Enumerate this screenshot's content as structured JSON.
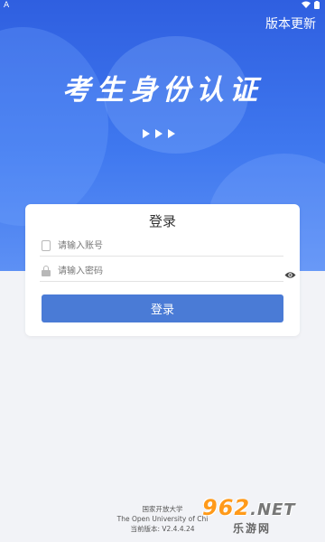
{
  "status_bar": {
    "left_icon": "A"
  },
  "header": {
    "update_label": "版本更新"
  },
  "hero": {
    "title": "考生身份认证"
  },
  "login_card": {
    "title": "登录",
    "account_placeholder": "请输入账号",
    "password_placeholder": "请输入密码",
    "login_button": "登录"
  },
  "footer": {
    "org_cn": "国家开放大学",
    "org_en": "The Open University of Chi",
    "version": "当前版本:  V2.4.4.24"
  },
  "watermark": {
    "top": "962",
    "net": ".NET",
    "bottom": "乐游网"
  },
  "colors": {
    "hero": "#3f78ef",
    "button": "#4a7bd6",
    "background": "#f2f3f7"
  }
}
